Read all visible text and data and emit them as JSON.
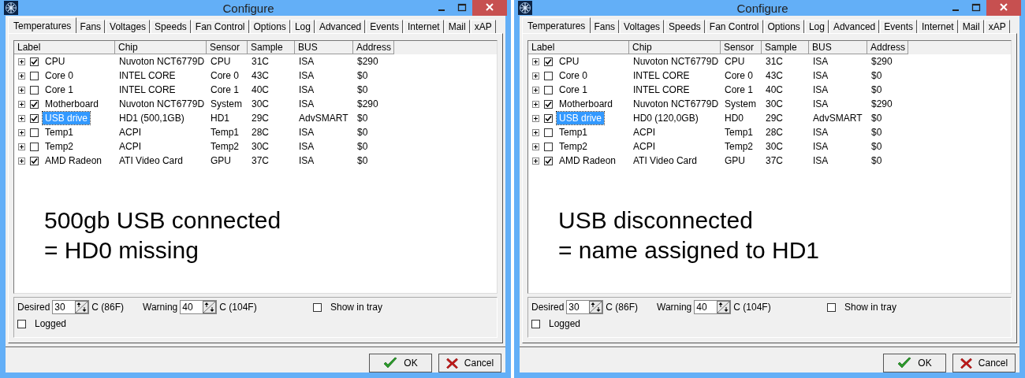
{
  "windows": [
    {
      "title": "Configure",
      "tabs": [
        {
          "label": "Temperatures",
          "selected": true
        },
        {
          "label": "Fans",
          "selected": false
        },
        {
          "label": "Voltages",
          "selected": false
        },
        {
          "label": "Speeds",
          "selected": false
        },
        {
          "label": "Fan Control",
          "selected": false
        },
        {
          "label": "Options",
          "selected": false
        },
        {
          "label": "Log",
          "selected": false
        },
        {
          "label": "Advanced",
          "selected": false
        },
        {
          "label": "Events",
          "selected": false
        },
        {
          "label": "Internet",
          "selected": false
        },
        {
          "label": "Mail",
          "selected": false
        },
        {
          "label": "xAP",
          "selected": false
        }
      ],
      "columns": [
        "Label",
        "Chip",
        "Sensor",
        "Sample",
        "BUS",
        "Address"
      ],
      "rows": [
        {
          "label": "CPU",
          "checked": true,
          "selected": false,
          "chip": "Nuvoton NCT6779D",
          "sensor": "CPU",
          "sample": "31C",
          "bus": "ISA",
          "address": "$290"
        },
        {
          "label": "Core 0",
          "checked": false,
          "selected": false,
          "chip": "INTEL CORE",
          "sensor": "Core 0",
          "sample": "43C",
          "bus": "ISA",
          "address": "$0"
        },
        {
          "label": "Core 1",
          "checked": false,
          "selected": false,
          "chip": "INTEL CORE",
          "sensor": "Core 1",
          "sample": "40C",
          "bus": "ISA",
          "address": "$0"
        },
        {
          "label": "Motherboard",
          "checked": true,
          "selected": false,
          "chip": "Nuvoton NCT6779D",
          "sensor": "System",
          "sample": "30C",
          "bus": "ISA",
          "address": "$290"
        },
        {
          "label": "USB drive",
          "checked": true,
          "selected": true,
          "chip": "HD1 (500,1GB)",
          "sensor": "HD1",
          "sample": "29C",
          "bus": "AdvSMART",
          "address": "$0"
        },
        {
          "label": "Temp1",
          "checked": false,
          "selected": false,
          "chip": "ACPI",
          "sensor": "Temp1",
          "sample": "28C",
          "bus": "ISA",
          "address": "$0"
        },
        {
          "label": "Temp2",
          "checked": false,
          "selected": false,
          "chip": "ACPI",
          "sensor": "Temp2",
          "sample": "30C",
          "bus": "ISA",
          "address": "$0"
        },
        {
          "label": "AMD Radeon",
          "checked": true,
          "selected": false,
          "chip": "ATI Video Card",
          "sensor": "GPU",
          "sample": "37C",
          "bus": "ISA",
          "address": "$0"
        }
      ],
      "annotation": [
        "500gb USB connected",
        "= HD0 missing"
      ],
      "desired": {
        "label": "Desired",
        "value": "30",
        "unit": "C (86F)"
      },
      "warning": {
        "label": "Warning",
        "value": "40",
        "unit": "C (104F)"
      },
      "show_in_tray": {
        "label": "Show in tray",
        "checked": false
      },
      "logged": {
        "label": "Logged",
        "checked": false
      },
      "buttons": [
        "OK",
        "Cancel"
      ]
    },
    {
      "title": "Configure",
      "tabs": [
        {
          "label": "Temperatures",
          "selected": true
        },
        {
          "label": "Fans",
          "selected": false
        },
        {
          "label": "Voltages",
          "selected": false
        },
        {
          "label": "Speeds",
          "selected": false
        },
        {
          "label": "Fan Control",
          "selected": false
        },
        {
          "label": "Options",
          "selected": false
        },
        {
          "label": "Log",
          "selected": false
        },
        {
          "label": "Advanced",
          "selected": false
        },
        {
          "label": "Events",
          "selected": false
        },
        {
          "label": "Internet",
          "selected": false
        },
        {
          "label": "Mail",
          "selected": false
        },
        {
          "label": "xAP",
          "selected": false
        }
      ],
      "columns": [
        "Label",
        "Chip",
        "Sensor",
        "Sample",
        "BUS",
        "Address"
      ],
      "rows": [
        {
          "label": "CPU",
          "checked": true,
          "selected": false,
          "chip": "Nuvoton NCT6779D",
          "sensor": "CPU",
          "sample": "31C",
          "bus": "ISA",
          "address": "$290"
        },
        {
          "label": "Core 0",
          "checked": false,
          "selected": false,
          "chip": "INTEL CORE",
          "sensor": "Core 0",
          "sample": "43C",
          "bus": "ISA",
          "address": "$0"
        },
        {
          "label": "Core 1",
          "checked": false,
          "selected": false,
          "chip": "INTEL CORE",
          "sensor": "Core 1",
          "sample": "40C",
          "bus": "ISA",
          "address": "$0"
        },
        {
          "label": "Motherboard",
          "checked": true,
          "selected": false,
          "chip": "Nuvoton NCT6779D",
          "sensor": "System",
          "sample": "30C",
          "bus": "ISA",
          "address": "$290"
        },
        {
          "label": "USB drive",
          "checked": true,
          "selected": true,
          "chip": "HD0 (120,0GB)",
          "sensor": "HD0",
          "sample": "29C",
          "bus": "AdvSMART",
          "address": "$0"
        },
        {
          "label": "Temp1",
          "checked": false,
          "selected": false,
          "chip": "ACPI",
          "sensor": "Temp1",
          "sample": "28C",
          "bus": "ISA",
          "address": "$0"
        },
        {
          "label": "Temp2",
          "checked": false,
          "selected": false,
          "chip": "ACPI",
          "sensor": "Temp2",
          "sample": "30C",
          "bus": "ISA",
          "address": "$0"
        },
        {
          "label": "AMD Radeon",
          "checked": true,
          "selected": false,
          "chip": "ATI Video Card",
          "sensor": "GPU",
          "sample": "37C",
          "bus": "ISA",
          "address": "$0"
        }
      ],
      "annotation": [
        "USB disconnected",
        "= name assigned to HD1"
      ],
      "desired": {
        "label": "Desired",
        "value": "30",
        "unit": "C (86F)"
      },
      "warning": {
        "label": "Warning",
        "value": "40",
        "unit": "C (104F)"
      },
      "show_in_tray": {
        "label": "Show in tray",
        "checked": false
      },
      "logged": {
        "label": "Logged",
        "checked": false
      },
      "buttons": [
        "OK",
        "Cancel"
      ]
    }
  ]
}
